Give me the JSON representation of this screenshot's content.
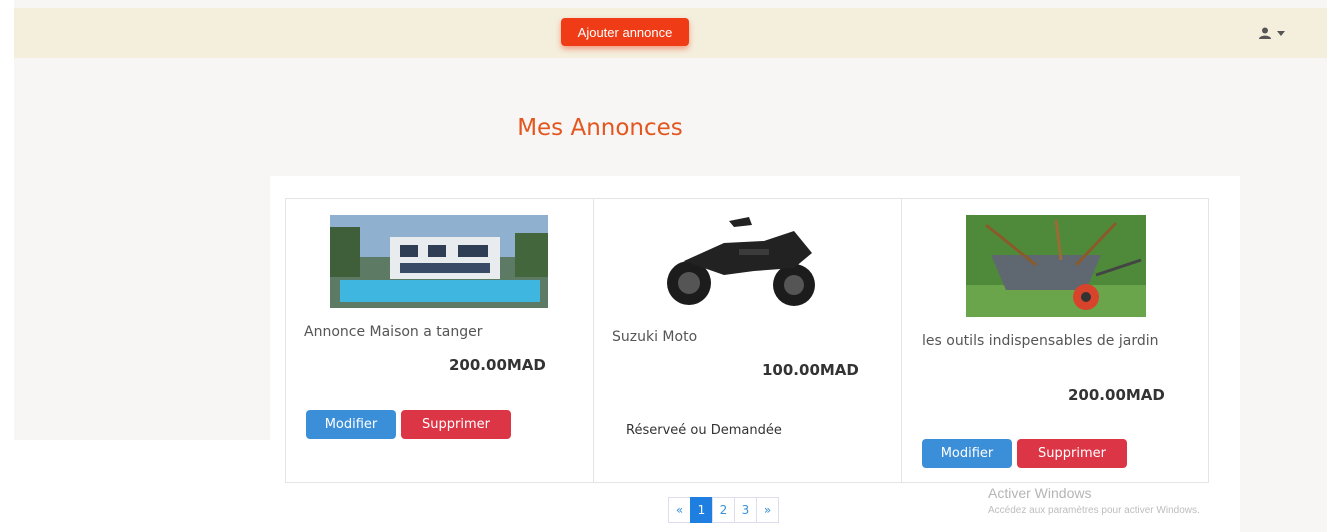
{
  "header": {
    "add_button": "Ajouter annonce",
    "user_icon": "user-icon"
  },
  "title": "Mes Annonces",
  "cards": [
    {
      "name": "Annonce Maison a tanger",
      "price": "200.00MAD",
      "edit": "Modifier",
      "delete": "Supprimer",
      "image": "house-image"
    },
    {
      "name": "Suzuki Moto",
      "price": "100.00MAD",
      "status": "Réserveé ou Demandée",
      "image": "motorcycle-image"
    },
    {
      "name": "les outils indispensables de jardin",
      "price": "200.00MAD",
      "edit": "Modifier",
      "delete": "Supprimer",
      "image": "wheelbarrow-image"
    }
  ],
  "pagination": {
    "prev": "«",
    "pages": [
      "1",
      "2",
      "3"
    ],
    "next": "»",
    "current": "1"
  },
  "watermark": {
    "line1": "Activer Windows",
    "line2": "Accédez aux paramètres pour activer Windows."
  },
  "colors": {
    "accent": "#ef3b16",
    "title": "#e3561e",
    "primary": "#3a8fd8",
    "danger": "#dc3545"
  }
}
